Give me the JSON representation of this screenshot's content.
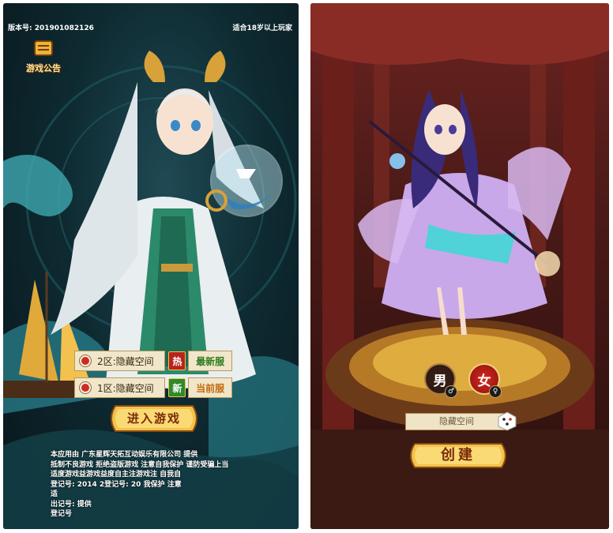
{
  "left_screen": {
    "version_label": "版本号: 201901082126",
    "age_notice": "适合18岁以上玩家",
    "notice_button": {
      "label": "游戏公告",
      "icon": "scroll-banner-icon"
    },
    "servers": [
      {
        "name": "2区:隐藏空间",
        "badge": "热",
        "status": "最新服"
      },
      {
        "name": "1区:隐藏空间",
        "badge": "新",
        "status": "当前服"
      }
    ],
    "enter_button": "进入游戏",
    "disclaimer": [
      "本应用由  广东星辉天拓互动娱乐有限公司  提供",
      "抵制不良游戏 拒绝盗版游戏 注意自我保护 谨防受骗上当",
      "适度游戏益游戏益度自主注游戏注  自我自",
      "登记号: 2014  2登记号: 20  我保护  注意",
      "  适     ",
      "出记号:        提供",
      "            登记号"
    ]
  },
  "right_screen": {
    "gender_male": {
      "label": "男",
      "symbol": "♂"
    },
    "gender_female": {
      "label": "女",
      "symbol": "♀"
    },
    "name_input": {
      "value": "隐藏空间"
    },
    "dice_icon": "dice-icon",
    "create_button": "创建"
  },
  "colors": {
    "left_bg": "#0e2a31",
    "right_bg": "#4a1a17",
    "gold": "#f1c24a",
    "red_accent": "#d12b20"
  }
}
